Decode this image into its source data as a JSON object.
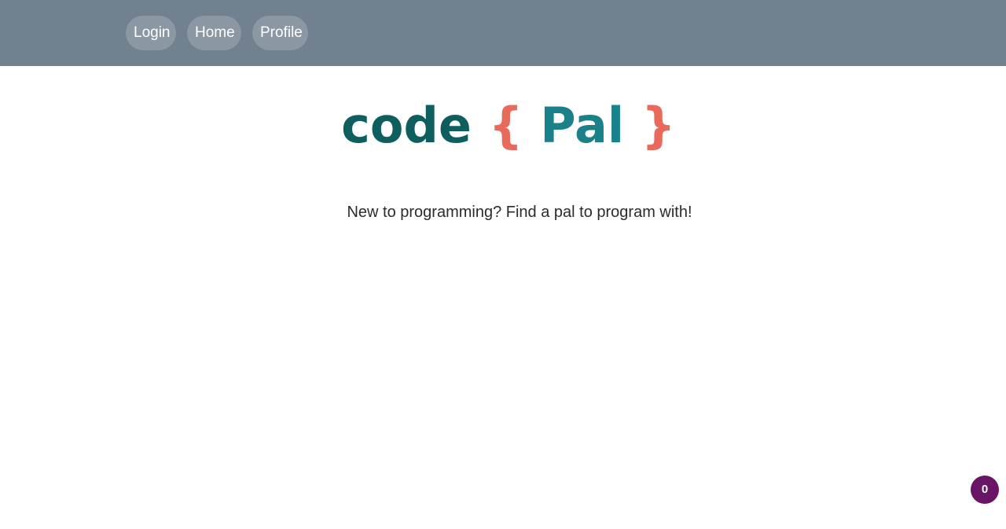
{
  "nav": {
    "login_label": "Login",
    "home_label": "Home",
    "profile_label": "Profile"
  },
  "logo": {
    "word1": "code",
    "open_brace": "{",
    "word2": "Pal",
    "close_brace": "}"
  },
  "tagline": "New to programming? Find a pal to program with!",
  "badge": {
    "count": "0"
  },
  "colors": {
    "navbar": "#72818f",
    "logo_code": "#0e5e5f",
    "logo_brace": "#e9695b",
    "logo_pal": "#1a8089",
    "badge": "#6a1466"
  }
}
